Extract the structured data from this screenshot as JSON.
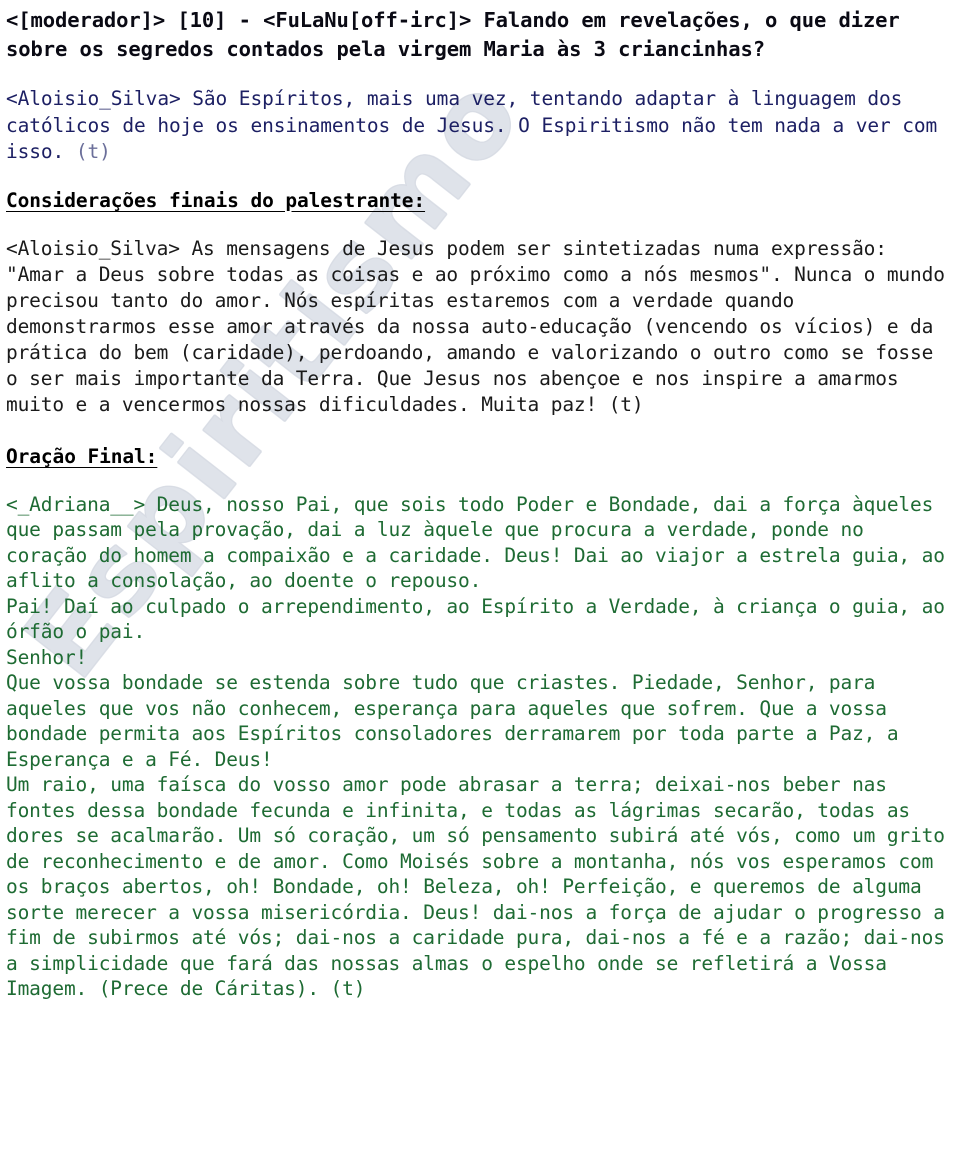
{
  "document": {
    "page_background": "#ffffff",
    "watermark_text": "Espiritismo",
    "colors": {
      "header_black": "#0a0a14",
      "answer_navy": "#1c1f63",
      "body_dark": "#1a1a1a",
      "prayer_green": "#1e6b33",
      "watermark_outline": "#dfe3ea"
    }
  },
  "question": {
    "text": "<[moderador]> [10] - <FuLaNu[off-irc]> Falando em revelações, o que dizer sobre os segredos contados pela virgem Maria às 3 criancinhas?"
  },
  "answer": {
    "text": "<Aloisio_Silva> São Espíritos, mais uma vez, tentando adaptar à linguagem dos católicos de hoje os ensinamentos de Jesus. O Espiritismo não tem nada a ver com isso. ",
    "marker": "(t)"
  },
  "final_considerations": {
    "heading": "Considerações finais do palestrante:",
    "text": "<Aloisio_Silva> As mensagens de Jesus podem ser sintetizadas numa expressão: \"Amar a Deus sobre todas as coisas e ao próximo como a nós mesmos\". Nunca o mundo precisou tanto do amor. Nós espíritas estaremos com a verdade quando demonstrarmos esse amor através da nossa auto-educação (vencendo os vícios) e da prática do bem (caridade), perdoando, amando e valorizando o outro como se fosse o ser mais importante da Terra. Que Jesus nos abençoe e nos inspire a amarmos muito e a vencermos nossas dificuldades. Muita paz! ",
    "marker": "(t)"
  },
  "final_prayer": {
    "heading": "Oração Final:",
    "text": "<_Adriana__> Deus, nosso Pai, que sois todo Poder e Bondade, dai a força àqueles que passam pela provação, dai a luz àquele que procura a verdade, ponde no coração do homem a compaixão e a caridade. Deus! Dai ao viajor a estrela guia, ao aflito a consolação, ao doente o repouso.\nPai! Daí ao culpado o arrependimento, ao Espírito a Verdade, à criança o guia, ao órfão o pai.\nSenhor!\nQue vossa bondade se estenda sobre tudo que criastes. Piedade, Senhor, para aqueles que vos não conhecem, esperança para aqueles que sofrem. Que a vossa bondade permita aos Espíritos consoladores derramarem por toda parte a Paz, a Esperança e a Fé. Deus!\nUm raio, uma faísca do vosso amor pode abrasar a terra; deixai-nos beber nas fontes dessa bondade fecunda e infinita, e todas as lágrimas secarão, todas as dores se acalmarão. Um só coração, um só pensamento subirá até vós, como um grito de reconhecimento e de amor. Como Moisés sobre a montanha, nós vos esperamos com os braços abertos, oh! Bondade, oh! Beleza, oh! Perfeição, e queremos de alguma sorte merecer a vossa misericórdia. Deus! dai-nos a força de ajudar o progresso a fim de subirmos até vós; dai-nos a caridade pura, dai-nos a fé e a razão; dai-nos a simplicidade que fará das nossas almas o espelho onde se refletirá a Vossa Imagem. (Prece de Cáritas). ",
    "marker": "(t)"
  }
}
